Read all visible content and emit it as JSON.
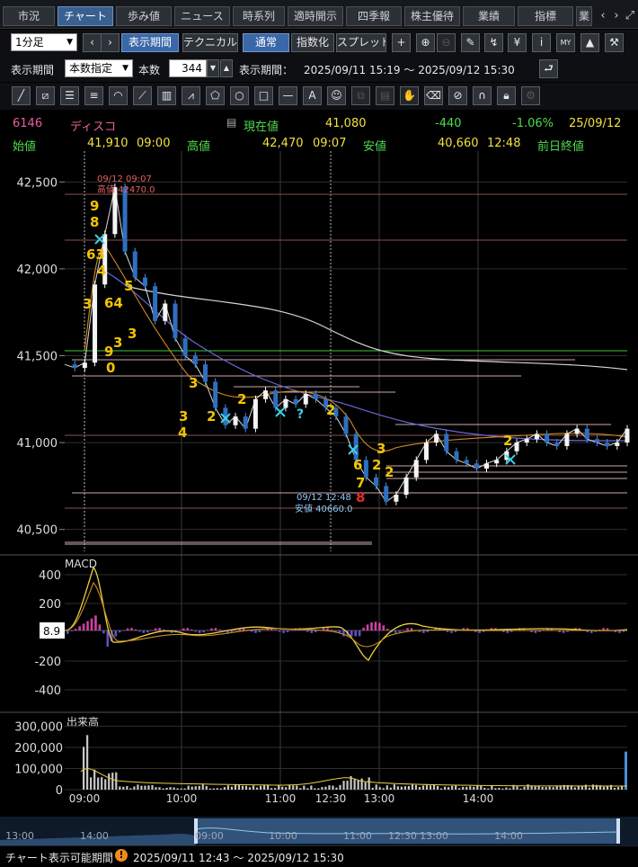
{
  "tabs": [
    "市況",
    "チャート",
    "歩み値",
    "ニュース",
    "時系列",
    "適時開示",
    "四季報",
    "株主優待",
    "業績",
    "指標",
    "業"
  ],
  "active_tab": 1,
  "toolbar": {
    "interval": "1分足",
    "period_btn": "表示期間",
    "technical_btn": "テクニカル",
    "normal_btn": "通常",
    "index_btn": "指数化",
    "spread_btn": "スプレッド",
    "yen": "¥",
    "info": "i"
  },
  "period_bar": {
    "label": "表示期間",
    "mode": "本数指定",
    "count_label": "本数",
    "count": "344",
    "range_label": "表示期間：",
    "range": "2025/09/11 15:19 ～ 2025/09/12 15:30"
  },
  "quote": {
    "code": "6146",
    "name": "ディスコ",
    "current_label": "現在値",
    "current": "41,080",
    "change": "-440",
    "change_pct": "-1.06%",
    "date": "25/09/12",
    "open_label": "始値",
    "open": "41,910",
    "open_time": "09:00",
    "high_label": "高値",
    "high": "42,470",
    "high_time": "09:07",
    "low_label": "安値",
    "low": "40,660",
    "low_time": "12:48",
    "prev_close_label": "前日終値"
  },
  "annotations": {
    "high_note_time": "09/12 09:07",
    "high_note_val": "高値 42470.0",
    "low_note_time": "09/12 12:48",
    "low_note_val": "安値 40660.0"
  },
  "panels": {
    "macd": "MACD",
    "volume": "出来高",
    "macd_value": "8.9"
  },
  "status": {
    "label": "チャート表示可能期間",
    "range": "2025/09/11 12:43 ～ 2025/09/12 15:30"
  },
  "colors": {
    "accent": "#3a67a8",
    "up": "#ffffff",
    "down": "#4a8fd8",
    "signal": "#f2c400",
    "quote_green": "#4fdc4f",
    "quote_yellow": "#f2e040"
  },
  "chart_data": {
    "type": "line",
    "price": {
      "ylim": [
        40400,
        42600
      ],
      "ticks": [
        40500,
        41000,
        41500,
        42000,
        42500
      ],
      "tick_labels": [
        "40,500",
        "41,000",
        "41,500",
        "42,000",
        "42,500"
      ]
    },
    "x_labels": [
      "09:00",
      "10:00",
      "11:00",
      "12:30",
      "13:00",
      "14:00"
    ],
    "series": [
      {
        "values": [
          41450,
          41430,
          41460,
          41910,
          42200,
          42470,
          42100,
          41950,
          41900,
          41700,
          41800,
          41600,
          41500,
          41450,
          41350,
          41200,
          41100,
          41150,
          41080,
          41250,
          41300,
          41200,
          41250,
          41220,
          41280,
          41250,
          41200,
          41150,
          41050,
          40900,
          40800,
          40750,
          40660,
          40700,
          40800,
          40900,
          41000,
          41050,
          40950,
          40900,
          40880,
          40850,
          40880,
          40900,
          40950,
          41000,
          41020,
          41050,
          41000,
          40980,
          41050,
          41080,
          41020,
          41000,
          40980,
          41000,
          41080
        ]
      }
    ],
    "macd": {
      "ylim": [
        -500,
        500
      ],
      "ticks": [
        400,
        200,
        -200,
        -400
      ],
      "tick_labels": [
        "400",
        "200",
        "-200",
        "-400"
      ]
    },
    "volume": {
      "ylim": [
        0,
        340000
      ],
      "ticks": [
        300000,
        200000,
        100000,
        0
      ],
      "tick_labels": [
        "300,000",
        "200,000",
        "100,000",
        "0"
      ]
    },
    "nav_labels": [
      "13:00",
      "14:00",
      "09:00",
      "10:00",
      "11:00",
      "12:30",
      "13:00",
      "14:00"
    ]
  }
}
